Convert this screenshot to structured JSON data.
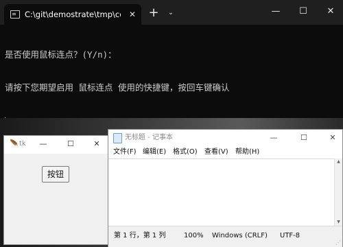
{
  "terminal": {
    "tab_title": "C:\\git\\demostrate\\tmp\\contin",
    "tab_close": "✕",
    "new_tab": "+",
    "dropdown": "⌄",
    "minimize": "—",
    "maximize": "☐",
    "close": "✕",
    "lines": [
      "是否使用鼠标连点？(Y/n)：",
      "请按下您期望启用 鼠标连点 使用的快捷键，按回车键确认"
    ]
  },
  "tk_window": {
    "title": "tk",
    "minimize": "—",
    "maximize": "☐",
    "close": "✕",
    "button_label": "按钮"
  },
  "notepad": {
    "title": "无标题 - 记事本",
    "minimize": "—",
    "maximize": "☐",
    "close": "✕",
    "menu": [
      "文件(F)",
      "编辑(E)",
      "格式(O)",
      "查看(V)",
      "帮助(H)"
    ],
    "scroll_up": "▲",
    "scroll_down": "▼",
    "status": {
      "position": "第 1 行，第 1 列",
      "zoom": "100%",
      "line_ending": "Windows (CRLF)",
      "encoding": "UTF-8"
    }
  },
  "colors": {
    "terminal_bg": "#0c0c0c",
    "terminal_titlebar": "#1f1f1f",
    "terminal_text": "#cccccc",
    "notepad_bg": "#ffffff",
    "statusbar_bg": "#f0f0f0"
  },
  "icons": [
    "terminal-tab-icon",
    "tk-feather-icon",
    "notepad-icon"
  ]
}
